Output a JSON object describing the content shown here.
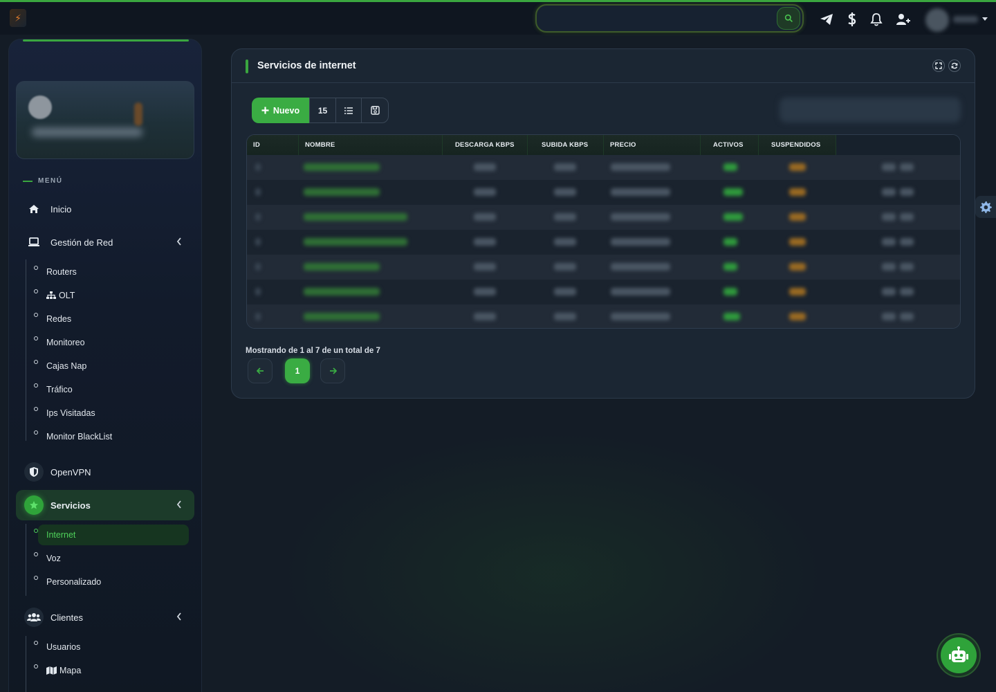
{
  "topbar": {
    "search_placeholder": "",
    "icons": [
      "telegram-icon",
      "dollar-icon",
      "bell-icon",
      "user-plus-icon"
    ]
  },
  "sidebar": {
    "menu_title": "MENÚ",
    "inicio": "Inicio",
    "gestion_red": "Gestión de Red",
    "gestion_sub": [
      "Routers",
      "OLT",
      "Redes",
      "Monitoreo",
      "Cajas Nap",
      "Tráfico",
      "Ips Visitadas",
      "Monitor BlackList"
    ],
    "openvpn": "OpenVPN",
    "servicios": "Servicios",
    "servicios_sub": [
      "Internet",
      "Voz",
      "Personalizado"
    ],
    "clientes": "Clientes",
    "clientes_sub": [
      "Usuarios",
      "Mapa"
    ]
  },
  "main": {
    "title": "Servicios de internet",
    "new_label": "Nuevo",
    "page_size": "15",
    "table": {
      "headers": [
        "ID",
        "NOMBRE",
        "DESCARGA KBPS",
        "SUBIDA KBPS",
        "PRECIO",
        "ACTIVOS",
        "SUSPENDIDOS"
      ],
      "row_count": 7
    },
    "info": "Mostrando de 1 al 7 de un total de 7",
    "current_page": "1"
  },
  "colors": {
    "accent": "#3aac43",
    "background": "#141c26",
    "card": "#1b2633",
    "suspended": "#b07a2a"
  }
}
